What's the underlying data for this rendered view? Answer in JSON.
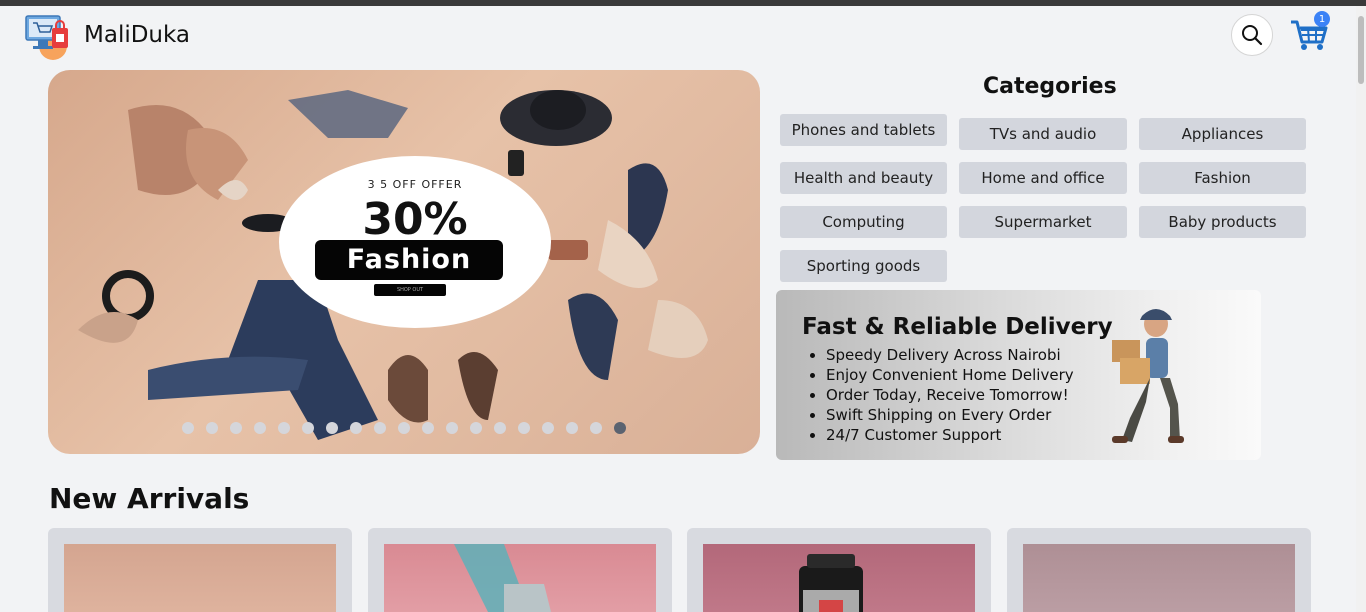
{
  "header": {
    "brand": "MaliDuka",
    "cart_count": "1",
    "logo_icon": "shop-logo-icon",
    "search_icon": "search-icon",
    "cart_icon": "shopping-cart-icon"
  },
  "hero": {
    "offer_small": "3 5 OFF OFFER",
    "offer_percent": "30%",
    "offer_tag": "Fashion",
    "offer_button": "SHOP OUT",
    "slide_count": 19,
    "active_slide": 19
  },
  "categories": {
    "title": "Categories",
    "items": [
      "Phones and tablets",
      "TVs and audio",
      "Appliances",
      "Health and beauty",
      "Home and office",
      "Fashion",
      "Computing",
      "Supermarket",
      "Baby products",
      "Sporting goods"
    ]
  },
  "delivery": {
    "title": "Fast & Reliable Delivery",
    "points": [
      "Speedy Delivery Across Nairobi",
      "Enjoy Convenient Home Delivery",
      "Order Today, Receive Tomorrow!",
      "Swift Shipping on Every Order",
      "24/7 Customer Support"
    ]
  },
  "new_arrivals": {
    "title": "New Arrivals",
    "cards": [
      {
        "color": "#d4a590"
      },
      {
        "color": "#d98a93"
      },
      {
        "color": "#b3687a"
      },
      {
        "color": "#ae8f95"
      }
    ]
  },
  "colors": {
    "accent": "#3b82f6",
    "category_bg": "#d3d6dd",
    "page_bg": "#f2f3f5"
  }
}
